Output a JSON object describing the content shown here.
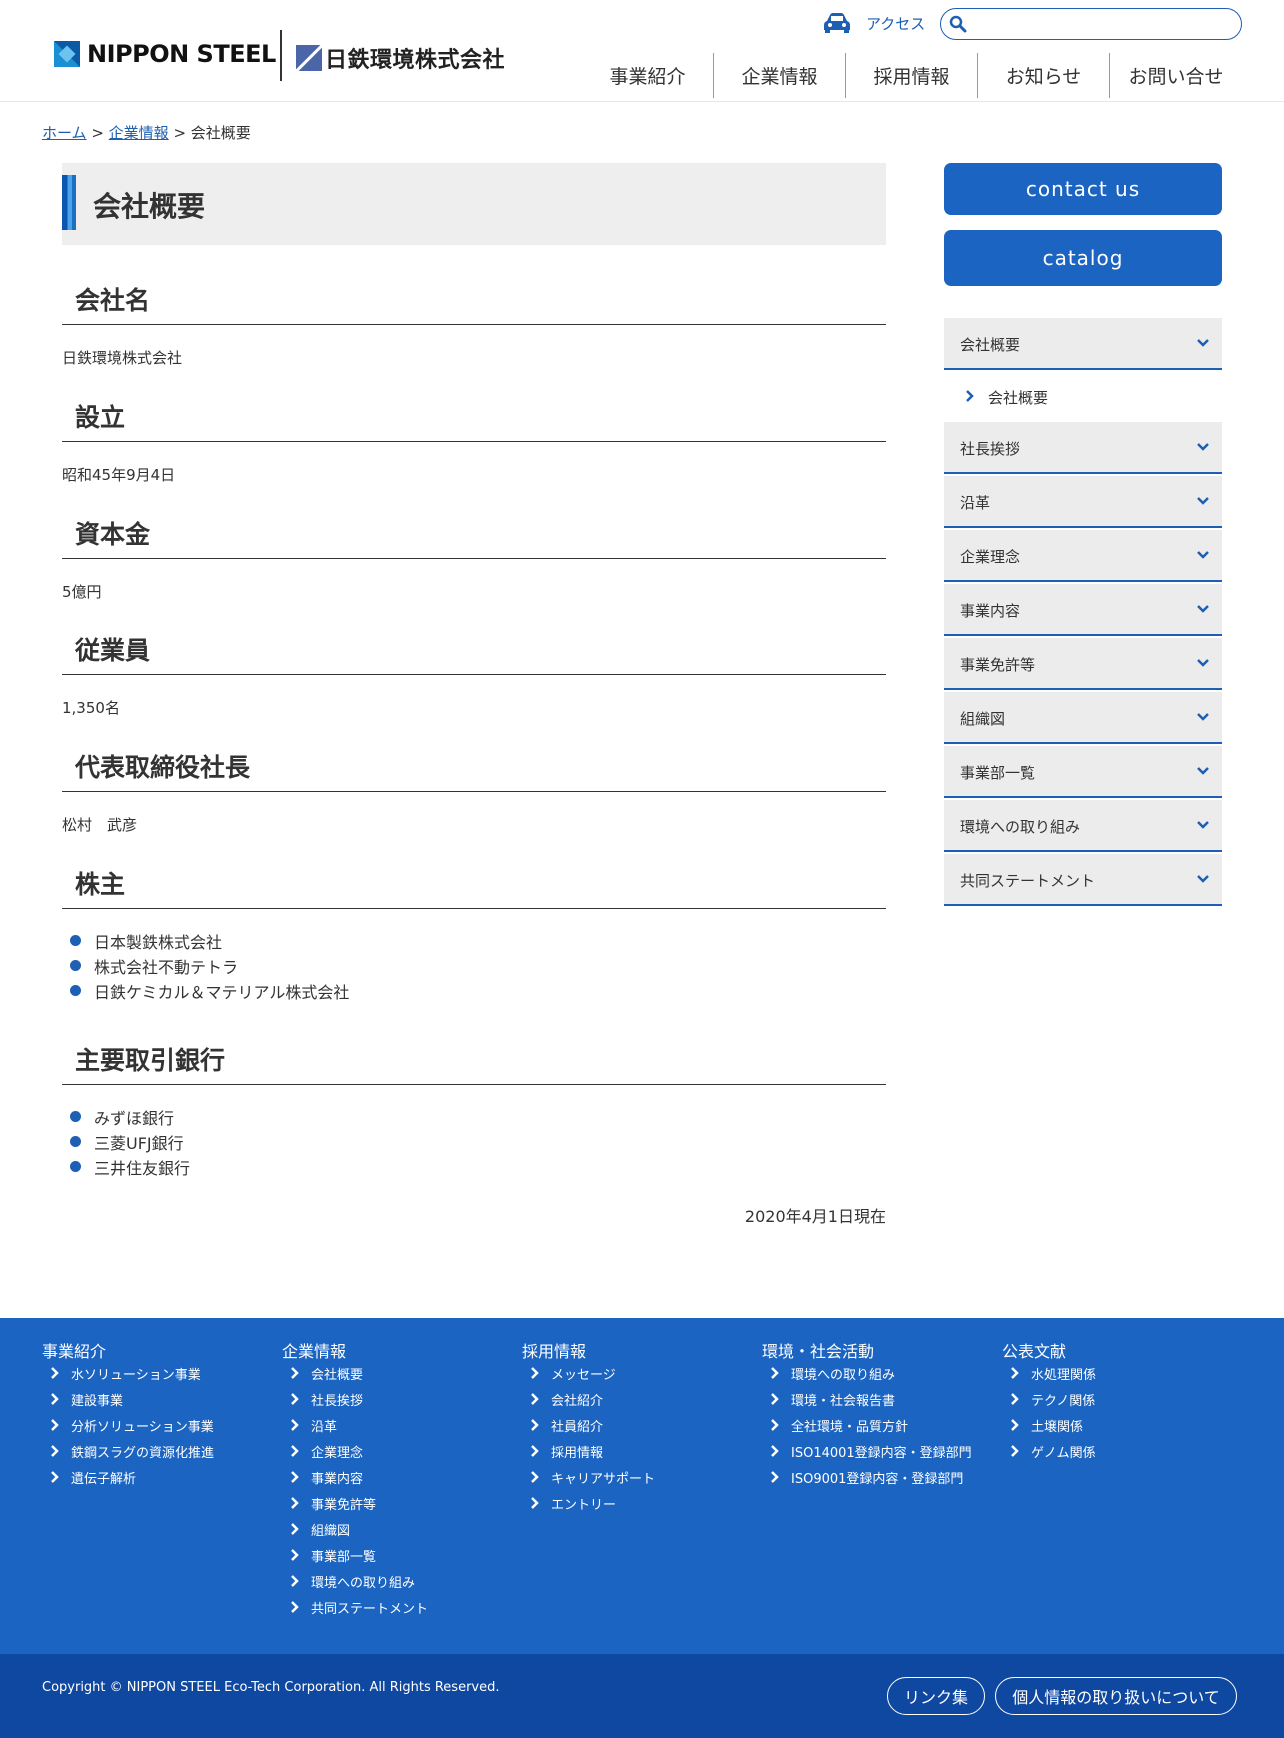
{
  "header": {
    "logo_nippon_steel": "NIPPON STEEL",
    "logo_company": "日鉄環境株式会社",
    "access_label": "アクセス",
    "search_placeholder": "",
    "nav": [
      "事業紹介",
      "企業情報",
      "採用情報",
      "お知らせ",
      "お問い合せ"
    ]
  },
  "breadcrumb": {
    "home": "ホーム",
    "sep1": " > ",
    "company": "企業情報",
    "sep2": " > ",
    "current": "会社概要"
  },
  "main": {
    "title": "会社概要",
    "sections": [
      {
        "heading": "会社名",
        "value": "日鉄環境株式会社"
      },
      {
        "heading": "設立",
        "value": "昭和45年9月4日"
      },
      {
        "heading": "資本金",
        "value": "5億円"
      },
      {
        "heading": "従業員",
        "value": "1,350名"
      },
      {
        "heading": "代表取締役社長",
        "value": "松村　武彦"
      }
    ],
    "shareholders": {
      "heading": "株主",
      "items": [
        "日本製鉄株式会社",
        "株式会社不動テトラ",
        "日鉄ケミカル＆マテリアル株式会社"
      ]
    },
    "banks": {
      "heading": "主要取引銀行",
      "items": [
        "みずほ銀行",
        "三菱UFJ銀行",
        "三井住友銀行"
      ]
    },
    "as_of": "2020年4月1日現在"
  },
  "sidebar": {
    "contact_label": "contact us",
    "catalog_label": "catalog",
    "menu": [
      "会社概要",
      "社長挨拶",
      "沿革",
      "企業理念",
      "事業内容",
      "事業免許等",
      "組織図",
      "事業部一覧",
      "環境への取り組み",
      "共同ステートメント"
    ],
    "submenu": "会社概要"
  },
  "footer": {
    "columns": [
      {
        "title": "事業紹介",
        "links": [
          "水ソリューション事業",
          "建設事業",
          "分析ソリューション事業",
          "鉄鋼スラグの資源化推進",
          "遺伝子解析"
        ]
      },
      {
        "title": "企業情報",
        "links": [
          "会社概要",
          "社長挨拶",
          "沿革",
          "企業理念",
          "事業内容",
          "事業免許等",
          "組織図",
          "事業部一覧",
          "環境への取り組み",
          "共同ステートメント"
        ]
      },
      {
        "title": "採用情報",
        "links": [
          "メッセージ",
          "会社紹介",
          "社員紹介",
          "採用情報",
          "キャリアサポート",
          "エントリー"
        ]
      },
      {
        "title": "環境・社会活動",
        "links": [
          "環境への取り組み",
          "環境・社会報告書",
          "全社環境・品質方針",
          "ISO14001登録内容・登録部門",
          "ISO9001登録内容・登録部門"
        ]
      },
      {
        "title": "公表文献",
        "links": [
          "水処理関係",
          "テクノ関係",
          "土壌関係",
          "ゲノム関係"
        ]
      }
    ],
    "copyright": "Copyright © NIPPON STEEL Eco-Tech Corporation. All Rights Reserved.",
    "link_collection": "リンク集",
    "privacy": "個人情報の取り扱いについて"
  },
  "colors": {
    "accent": "#1b64c2",
    "footer_bottom": "#0f48a0",
    "sidebar_bg": "#ececec"
  }
}
